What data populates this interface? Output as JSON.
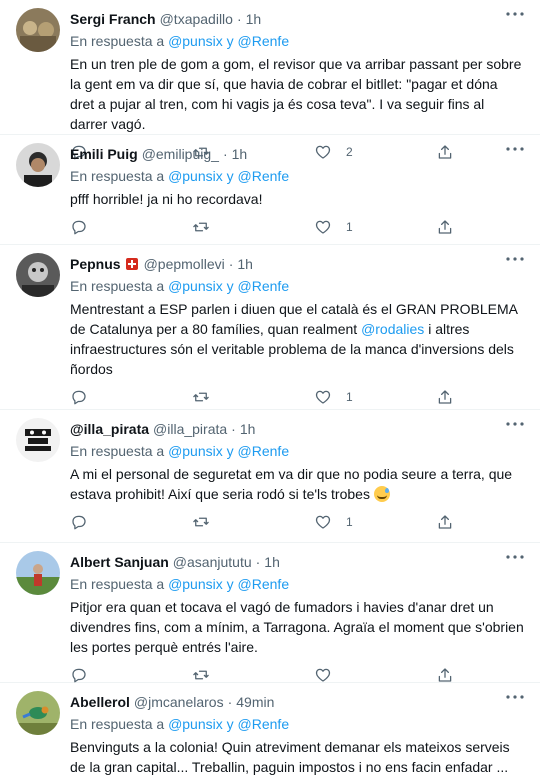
{
  "tweets": [
    {
      "name": "Sergi Franch",
      "handle": "@txapadillo",
      "time": "1h",
      "reply_prefix": "En respuesta a",
      "reply_user1": "@punsix",
      "reply_and": "y",
      "reply_user2": "@Renfe",
      "text": "En un tren ple de gom a gom, el revisor que va arribar passant per sobre la gent em va dir que sí, que havia de cobrar el bitllet: \"pagar et dóna dret a pujar al tren, com hi vagis ja és cosa teva\". I va seguir fins al darrer vagó.",
      "likes": "2"
    },
    {
      "name": "Emili Puig",
      "handle": "@emilipuig_",
      "time": "1h",
      "reply_prefix": "En respuesta a",
      "reply_user1": "@punsix",
      "reply_and": "y",
      "reply_user2": "@Renfe",
      "text": "pfff horrible! ja ni ho recordava!",
      "likes": "1"
    },
    {
      "name": "Pepnus",
      "handle": "@pepmollevi",
      "time": "1h",
      "badge_icon": "swiss-flag-icon",
      "reply_prefix": "En respuesta a",
      "reply_user1": "@punsix",
      "reply_and": "y",
      "reply_user2": "@Renfe",
      "text_before": "Mentrestant a ESP parlen i diuen que el català és el GRAN PROBLEMA de Catalunya per a 80 famílies, quan realment ",
      "text_mention": "@rodalies",
      "text_after": " i altres infraestructures són el veritable problema de la manca d'inversions dels ñordos",
      "likes": "1"
    },
    {
      "name": "@illa_pirata",
      "handle": "@illa_pirata",
      "time": "1h",
      "reply_prefix": "En respuesta a",
      "reply_user1": "@punsix",
      "reply_and": "y",
      "reply_user2": "@Renfe",
      "text": "A mi el personal de seguretat em va dir que no podia seure a terra, que estava prohibit! Així que seria rodó si te'ls trobes",
      "emoji_icon": "sweat-smile-emoji-icon",
      "likes": "1"
    },
    {
      "name": "Albert Sanjuan",
      "handle": "@asanjututu",
      "time": "1h",
      "reply_prefix": "En respuesta a",
      "reply_user1": "@punsix",
      "reply_and": "y",
      "reply_user2": "@Renfe",
      "text": "Pitjor era quan et tocava el vagó de fumadors i havies d'anar dret un divendres fins, com a mínim, a Tarragona. Agraïa el moment que s'obrien les portes perquè entrés l'aire.",
      "likes": ""
    },
    {
      "name": "Abellerol",
      "handle": "@jmcanelaros",
      "time": "49min",
      "reply_prefix": "En respuesta a",
      "reply_user1": "@punsix",
      "reply_and": "y",
      "reply_user2": "@Renfe",
      "text": "Benvinguts a la colonia! Quin atreviment demanar els mateixos serveis de la gran capital... Treballin, paguin impostos i no ens facin enfadar ...",
      "likes": ""
    }
  ],
  "colors": {
    "accent": "#1d9bf0",
    "muted": "#536471",
    "text": "#0f1419"
  },
  "icons": [
    "more-icon",
    "reply-icon",
    "retweet-icon",
    "like-icon",
    "share-icon"
  ]
}
